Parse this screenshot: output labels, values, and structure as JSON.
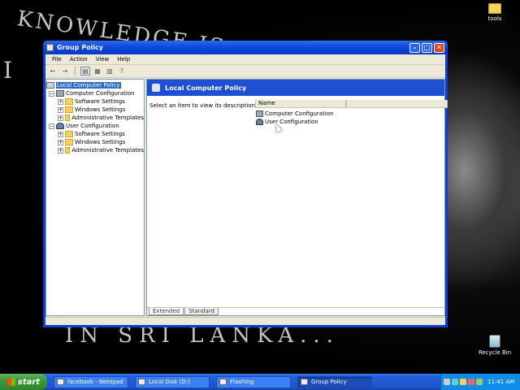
{
  "desktop": {
    "wallpaper_text_top": "KNOWLEDGE IS",
    "wallpaper_text_left": "I",
    "wallpaper_text_bottom": "IN SRI LANKA...",
    "icons": [
      {
        "label": "tools",
        "icon": "folder-icon"
      },
      {
        "label": "Recycle Bin",
        "icon": "recycle-bin-icon"
      }
    ]
  },
  "window": {
    "title": "Group Policy",
    "menu": [
      "File",
      "Action",
      "View",
      "Help"
    ],
    "toolbar": [
      "back-arrow-icon",
      "forward-arrow-icon",
      "show-hide-tree-icon",
      "properties-icon",
      "export-list-icon",
      "help-icon"
    ],
    "tree": {
      "root": "Local Computer Policy",
      "computer_configuration": {
        "label": "Computer Configuration",
        "children": [
          "Software Settings",
          "Windows Settings",
          "Administrative Templates"
        ]
      },
      "user_configuration": {
        "label": "User Configuration",
        "children": [
          "Software Settings",
          "Windows Settings",
          "Administrative Templates"
        ]
      }
    },
    "right_pane": {
      "header": "Local Computer Policy",
      "description": "Select an item to view its description.",
      "column_name": "Name",
      "items": [
        "Computer Configuration",
        "User Configuration"
      ]
    },
    "tabs": [
      "Extended",
      "Standard"
    ],
    "active_tab": "Extended"
  },
  "taskbar": {
    "start_label": "start",
    "tasks": [
      {
        "label": "facebook - Notepad",
        "active": false
      },
      {
        "label": "Local Disk (D:)",
        "active": false
      },
      {
        "label": "Flashing",
        "active": false
      },
      {
        "label": "Group Policy",
        "active": true
      }
    ],
    "clock": "11:41 AM"
  },
  "colors": {
    "titlebar": "#0a47d9",
    "header_band": "#1d4fd2",
    "selection": "#316ac5",
    "taskbar": "#245edb",
    "start_button": "#3a9a3a",
    "tray": "#0f8be8"
  }
}
